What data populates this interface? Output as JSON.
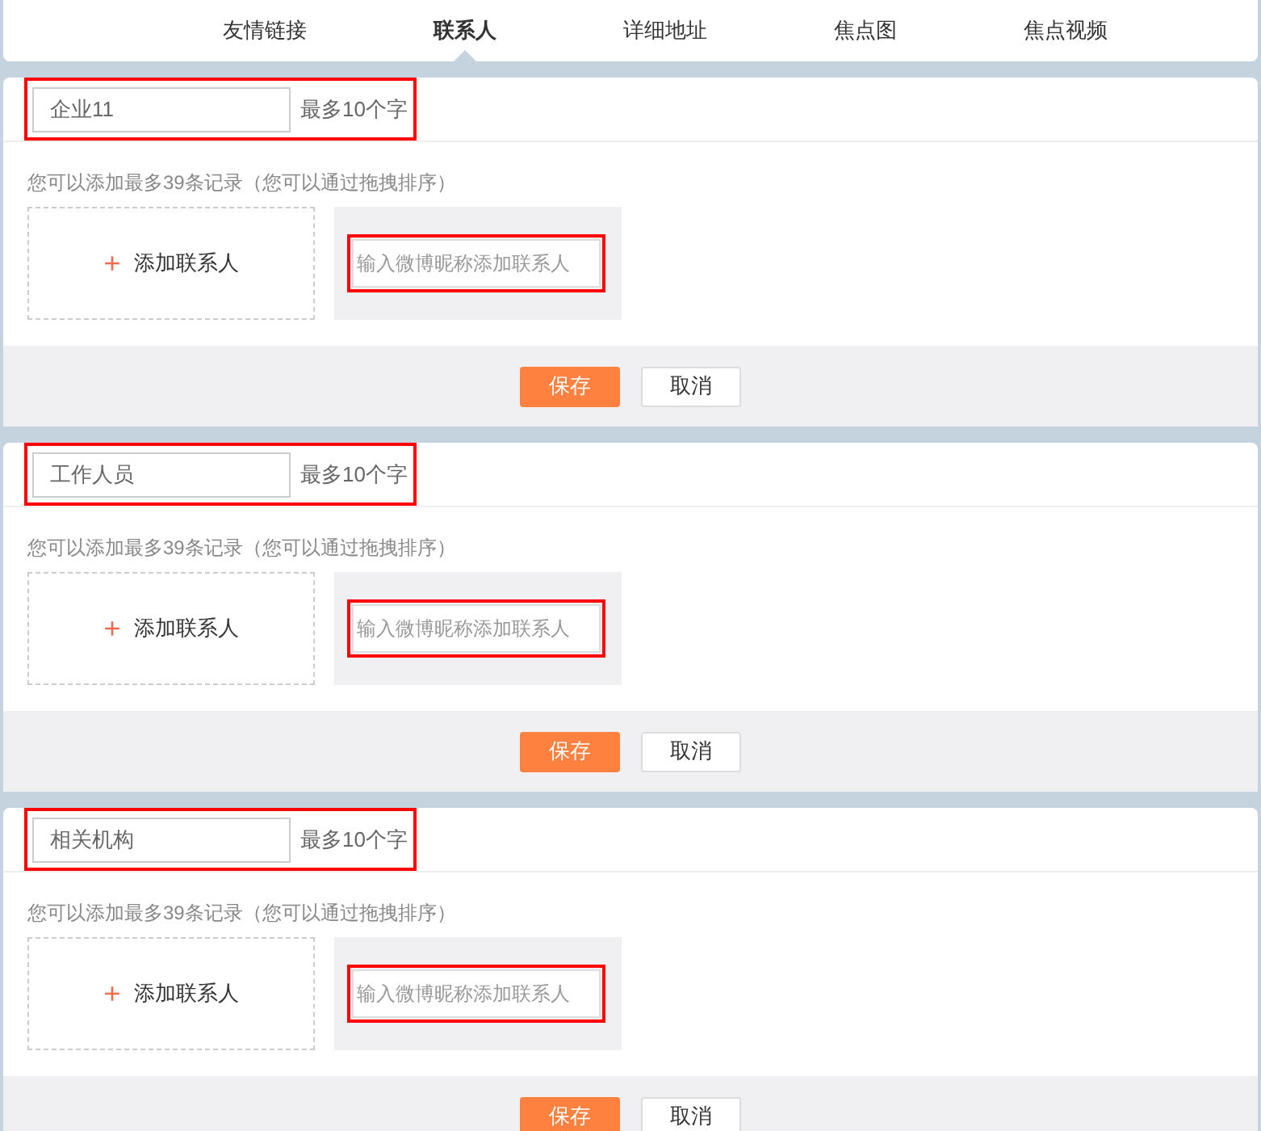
{
  "tabs": [
    {
      "label": "友情链接",
      "selected": false
    },
    {
      "label": "联系人",
      "selected": true
    },
    {
      "label": "详细地址",
      "selected": false
    },
    {
      "label": "焦点图",
      "selected": false
    },
    {
      "label": "焦点视频",
      "selected": false
    }
  ],
  "sections": [
    {
      "name_value": "企业11",
      "limit_hint": "最多10个字",
      "records_hint": "您可以添加最多39条记录（您可以通过拖拽排序）",
      "add_label": "添加联系人",
      "add_icon": "+",
      "search_placeholder": "输入微博昵称添加联系人",
      "save": "保存",
      "cancel": "取消"
    },
    {
      "name_value": "工作人员",
      "limit_hint": "最多10个字",
      "records_hint": "您可以添加最多39条记录（您可以通过拖拽排序）",
      "add_label": "添加联系人",
      "add_icon": "+",
      "search_placeholder": "输入微博昵称添加联系人",
      "save": "保存",
      "cancel": "取消"
    },
    {
      "name_value": "相关机构",
      "limit_hint": "最多10个字",
      "records_hint": "您可以添加最多39条记录（您可以通过拖拽排序）",
      "add_label": "添加联系人",
      "add_icon": "+",
      "search_placeholder": "输入微博昵称添加联系人",
      "save": "保存",
      "cancel": "取消"
    }
  ]
}
